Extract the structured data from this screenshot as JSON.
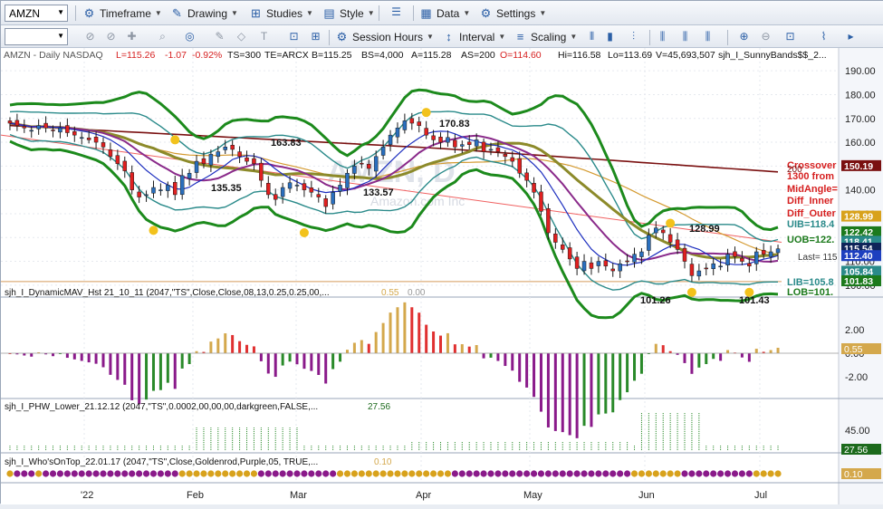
{
  "toolbar": {
    "symbol": "AMZN",
    "timeframe": "Timeframe",
    "drawing": "Drawing",
    "studies": "Studies",
    "style": "Style",
    "data": "Data",
    "settings": "Settings",
    "session_hours": "Session Hours",
    "interval": "Interval",
    "scaling": "Scaling"
  },
  "header": {
    "symbol_info": "AMZN - Daily  NASDAQ",
    "last": "L=115.26",
    "change": "-1.07",
    "change_pct": "-0.92%",
    "ts": "TS=300",
    "te": "TE=ARCX",
    "bid": "B=115.25",
    "bid_size": "BS=4,000",
    "ask": "A=115.28",
    "ask_size": "AS=200",
    "open": "O=114.60",
    "high": "Hi=116.58",
    "low": "Lo=113.69",
    "volume": "V=45,693,507",
    "study_name": "sjh_I_SunnyBands$$_2...",
    "watermark_symbol": "AMZN, D",
    "watermark_name": "Amazon.com Inc"
  },
  "price_axis": {
    "ticks": [
      "190.00",
      "180.00",
      "170.00",
      "160.00",
      "150.00",
      "140.00",
      "130.00",
      "120.00",
      "110.00",
      "100.00"
    ],
    "markers": [
      {
        "label": "150.19",
        "color": "#7a1010"
      },
      {
        "label": "128.99",
        "color": "#d8a21c"
      },
      {
        "label": "122.42",
        "color": "#1c7a1c"
      },
      {
        "label": "118.41",
        "color": "#2a8a8a"
      },
      {
        "label": "115.54",
        "color": "#10255a"
      },
      {
        "label": "112.40",
        "color": "#1d3fbf"
      },
      {
        "label": "105.84",
        "color": "#2a8a8a"
      },
      {
        "label": "101.83",
        "color": "#1c7a1c"
      }
    ]
  },
  "price_labels": {
    "swing_highs": [
      "170.83",
      "163.83",
      "128.99"
    ],
    "swing_lows": [
      "135.35",
      "133.57",
      "101.26",
      "101.43"
    ],
    "band_labels": [
      "UOB=122.",
      "UIB=118.4",
      "LIB=105.8",
      "LOB=101."
    ],
    "ma200": "200",
    "annotations": [
      "Crossover",
      "1300 from",
      "MidAngle=",
      "Diff_Inner",
      "Diff_Outer"
    ],
    "last_label": "Last= 115"
  },
  "panels": [
    {
      "title": "sjh_I_DynamicMAV_Hst 21_10_11 (2047,\"TS\",Close,Close,08,13,0.25,0.25,00,...",
      "v1": "0.55",
      "v2": "0.00",
      "ticks": [
        "2.00",
        "0.00",
        "-2.00"
      ],
      "marker": "0.55",
      "marker_color": "#d4a84c"
    },
    {
      "title": "sjh_I_PHW_Lower_21.12.12 (2047,\"TS\",0.0002,00,00,00,darkgreen,FALSE,...",
      "v1": "27.56",
      "ticks": [
        "45.00"
      ],
      "marker": "27.56",
      "marker_color": "#1c6a1c"
    },
    {
      "title": "sjh_I_Who'sOnTop_22.01.17 (2047,\"TS\",Close,Goldenrod,Purple,05, TRUE,...",
      "v1": "0.10",
      "marker": "0.10",
      "marker_color": "#d4a84c"
    }
  ],
  "time_axis": [
    "'22",
    "Feb",
    "Mar",
    "Apr",
    "May",
    "Jun",
    "Jul"
  ],
  "chart_data": {
    "type": "candlestick",
    "closes": [
      168,
      167,
      166,
      165,
      167,
      166,
      165,
      166,
      164,
      163,
      162,
      161,
      160,
      158,
      154,
      151,
      148,
      140,
      137,
      138,
      141,
      140,
      142,
      138,
      146,
      147,
      152,
      151,
      155,
      156,
      158,
      157,
      154,
      152,
      151,
      144,
      138,
      136,
      141,
      143,
      142,
      140,
      139,
      137,
      133,
      139,
      142,
      147,
      150,
      151,
      149,
      154,
      158,
      163,
      166,
      169,
      168,
      167,
      163,
      161,
      160,
      162,
      158,
      159,
      159,
      161,
      156,
      157,
      156,
      154,
      152,
      147,
      144,
      139,
      131,
      122,
      118,
      115,
      111,
      107,
      110,
      107,
      110,
      108,
      106,
      109,
      110,
      113,
      114,
      121,
      124,
      122,
      118,
      115,
      110,
      104,
      106,
      107,
      109,
      108,
      113,
      112,
      110,
      108,
      114,
      113,
      114,
      115.26
    ],
    "annotated_high_low": [
      170.83,
      163.83,
      128.99,
      135.35,
      133.57,
      101.26,
      101.43
    ],
    "ylim": [
      95,
      195
    ]
  },
  "colors": {
    "up": "#2a6fbe",
    "down": "#e02020",
    "band_outer": "#1c8a1c",
    "band_inner": "#2a8a8a",
    "ma200": "#7a1010",
    "trend": "#f06060",
    "hist_pos_strong": "#e03030",
    "hist_pos_weak": "#d4a84c",
    "hist_neg_strong": "#8a1a8a",
    "hist_neg_weak": "#2a8a2a"
  }
}
